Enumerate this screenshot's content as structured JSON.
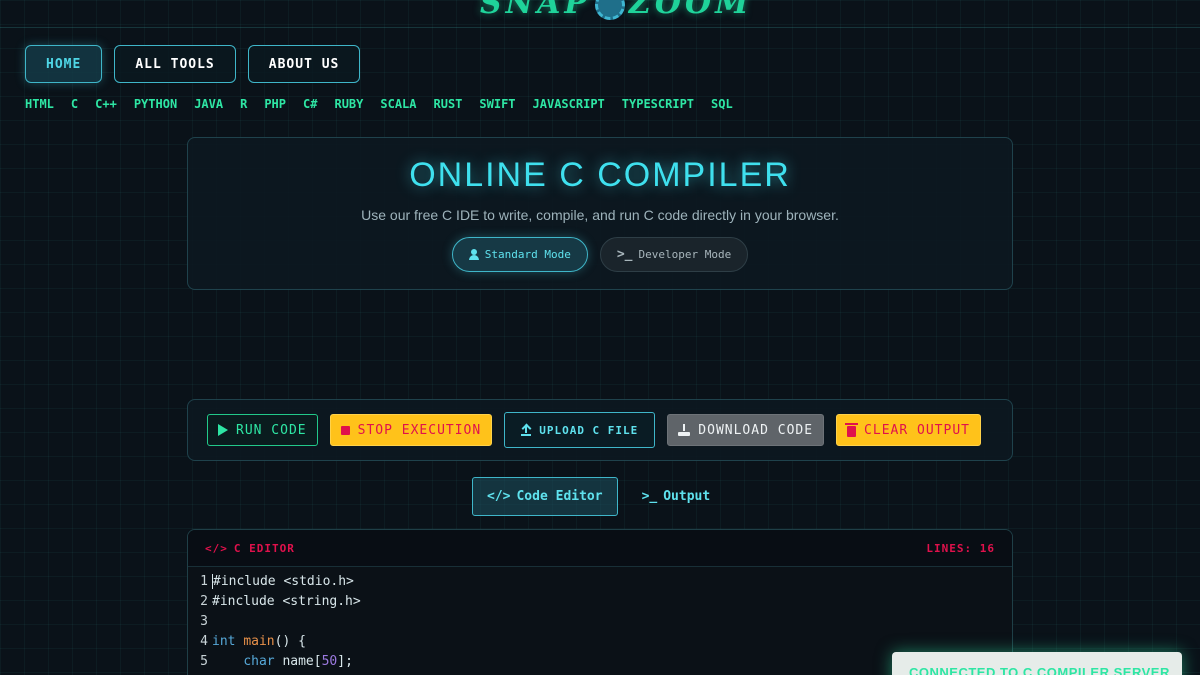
{
  "logo": {
    "text_left": "SNAP",
    "text_right": "ZOOM"
  },
  "nav": [
    {
      "label": "HOME"
    },
    {
      "label": "ALL TOOLS"
    },
    {
      "label": "ABOUT US"
    }
  ],
  "languages": [
    "HTML",
    "C",
    "C++",
    "PYTHON",
    "JAVA",
    "R",
    "PHP",
    "C#",
    "RUBY",
    "SCALA",
    "RUST",
    "SWIFT",
    "JAVASCRIPT",
    "TYPESCRIPT",
    "SQL"
  ],
  "hero": {
    "title": "ONLINE C COMPILER",
    "subtitle": "Use our free C IDE to write, compile, and run C code directly in your browser.",
    "modes": {
      "standard": "Standard Mode",
      "developer": "Developer Mode"
    }
  },
  "toolbar": {
    "run": "RUN CODE",
    "stop": "STOP EXECUTION",
    "upload": "UPLOAD C FILE",
    "download": "DOWNLOAD CODE",
    "clear": "CLEAR OUTPUT"
  },
  "tabs": {
    "editor": "Code Editor",
    "output": "Output"
  },
  "editor": {
    "title": "C EDITOR",
    "lines_label": "LINES: 16",
    "code": [
      {
        "n": "1",
        "text": "#include <stdio.h>"
      },
      {
        "n": "2",
        "text": "#include <string.h>"
      },
      {
        "n": "3",
        "text": ""
      },
      {
        "n": "4",
        "kw": "int",
        "fn": "main",
        "rest": "() {"
      },
      {
        "n": "5",
        "indent": "    ",
        "kw": "char",
        "mid": " name[",
        "num": "50",
        "end": "];"
      }
    ]
  },
  "toast": {
    "text": "CONNECTED TO C COMPILER SERVER"
  },
  "colors": {
    "accent": "#3fe0ee",
    "green": "#2ee6a4",
    "warn": "#ffc21a",
    "danger": "#e0114c"
  }
}
